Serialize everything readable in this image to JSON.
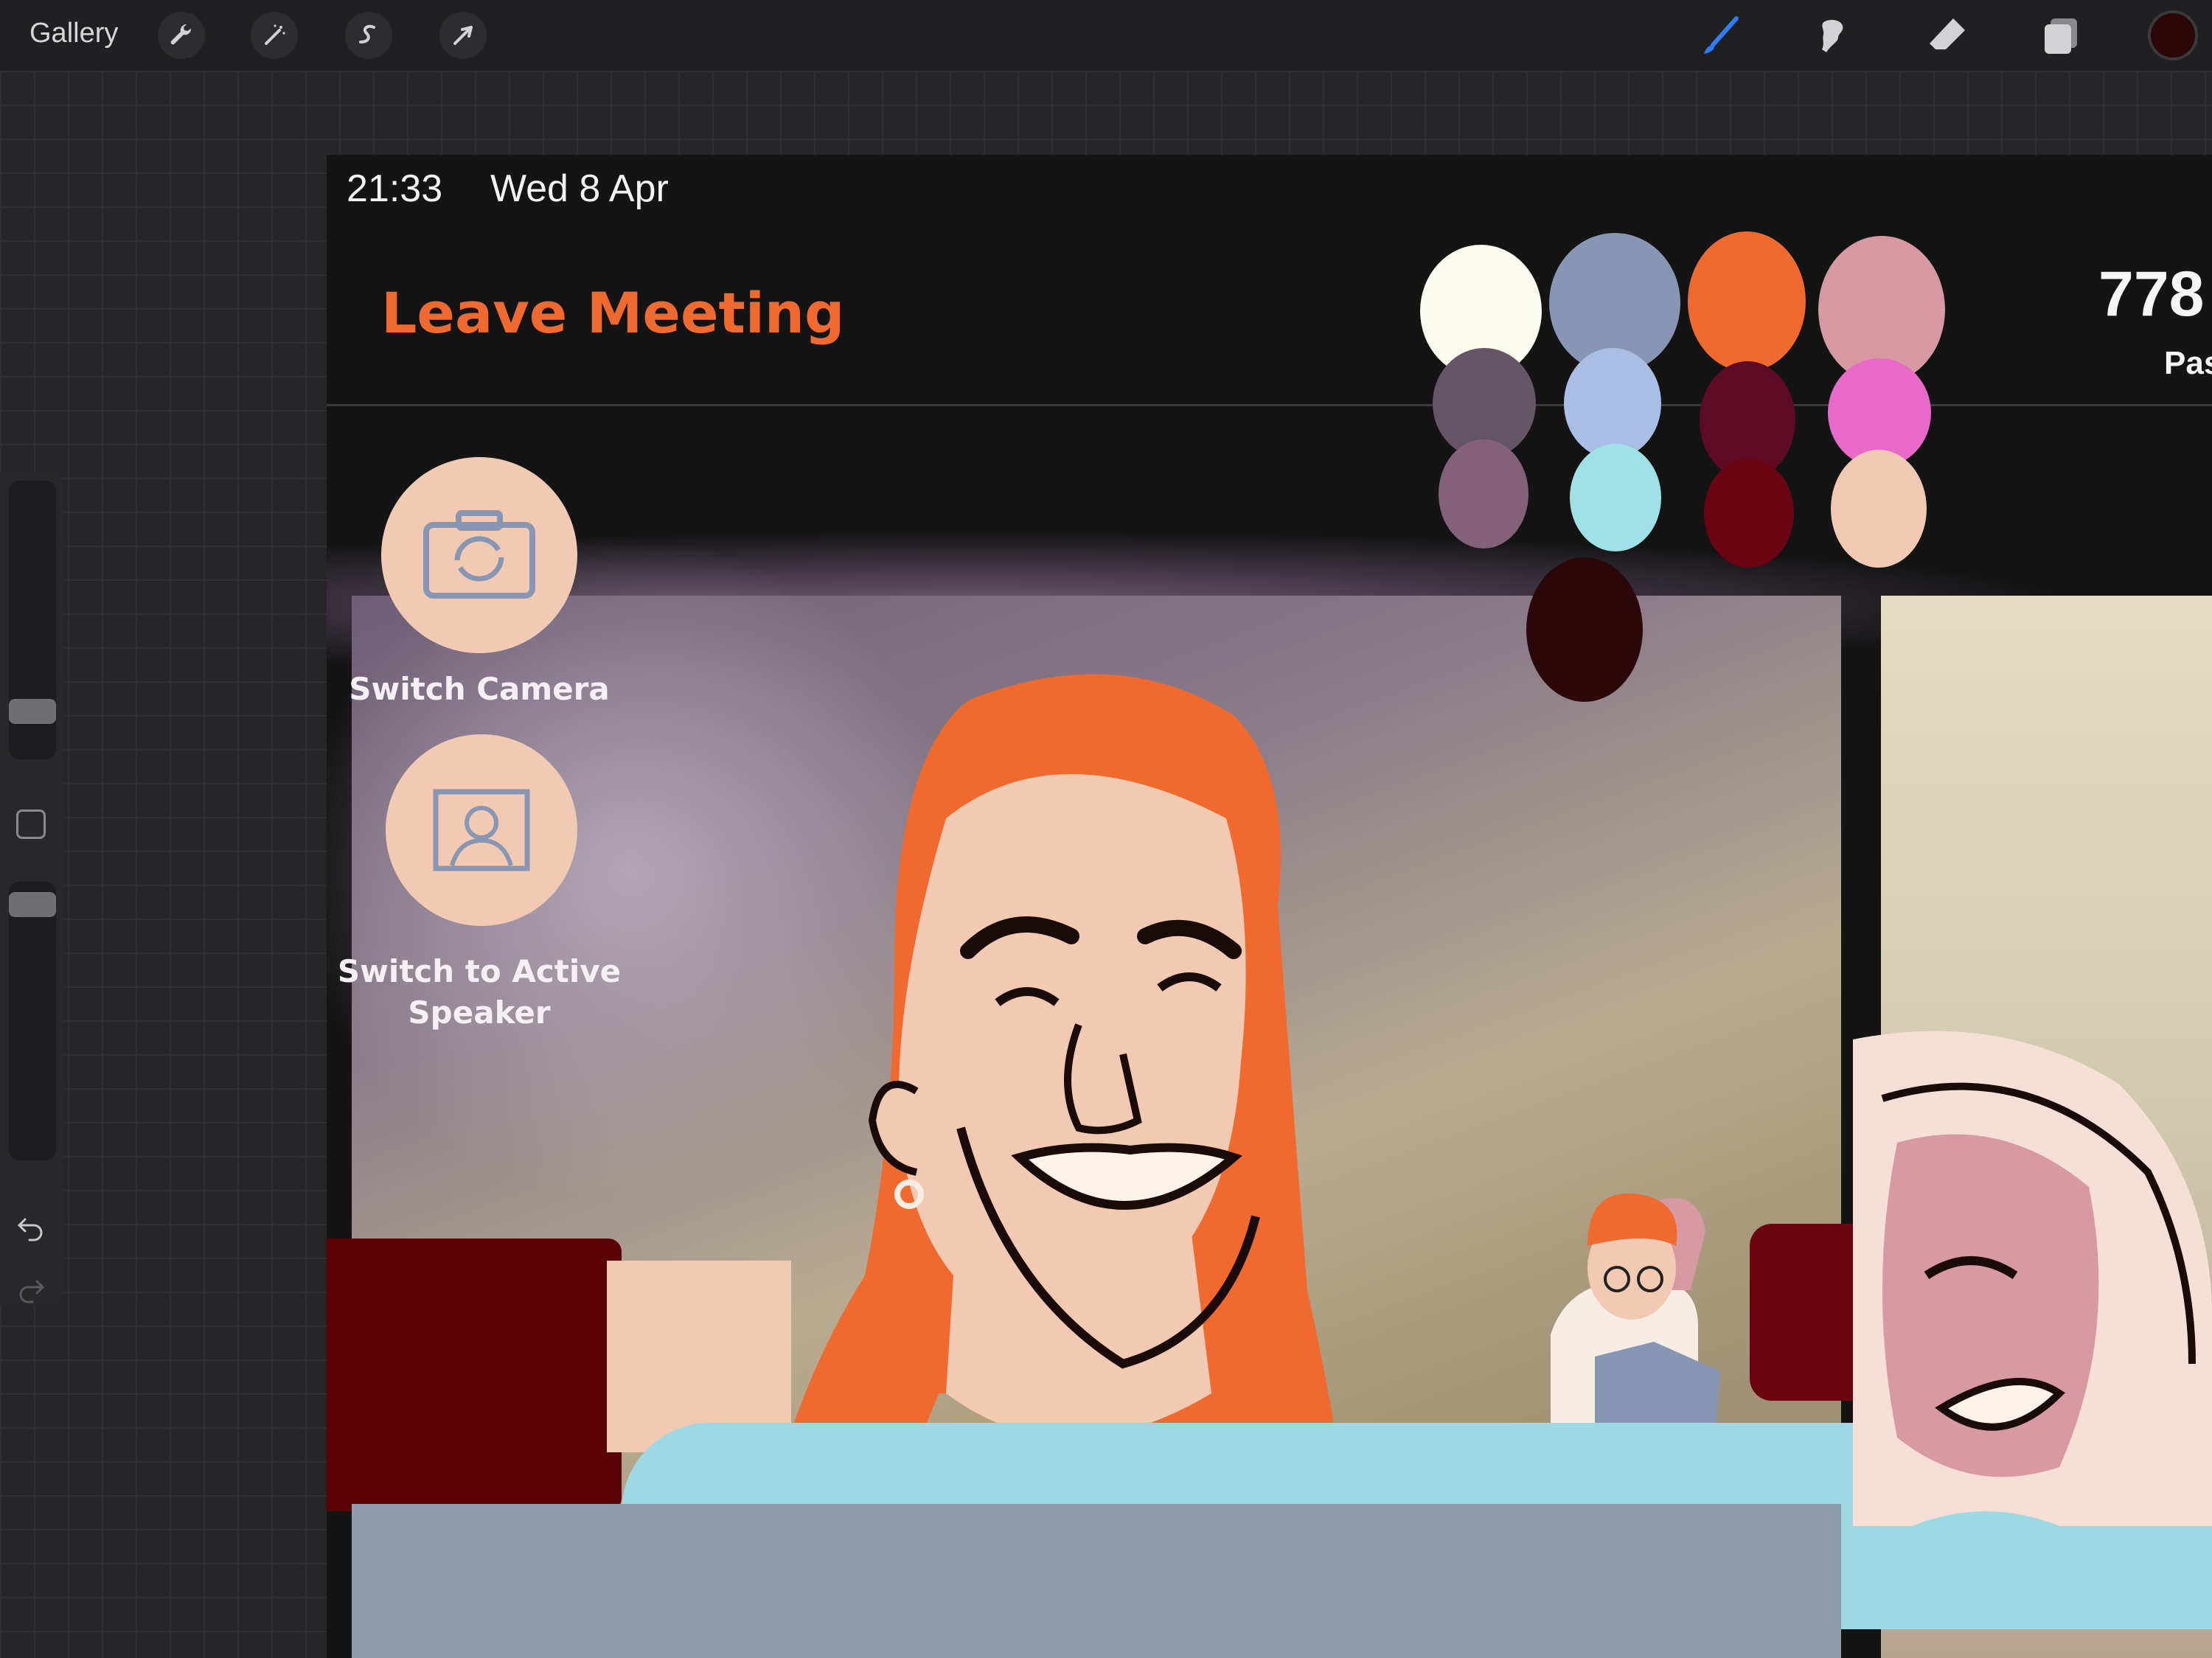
{
  "toolbar": {
    "gallery_label": "Gallery",
    "left_tools": [
      "wrench-icon",
      "magic-wand-icon",
      "selection-icon",
      "transform-arrow-icon"
    ],
    "right_tools": [
      "brush-icon",
      "smudge-icon",
      "eraser-icon",
      "layers-icon"
    ],
    "current_color": "#2b0707",
    "active_tool_color": "#2f7cf6"
  },
  "sidebar": {
    "brush_size_label": "brush-size-slider",
    "opacity_label": "opacity-slider",
    "modify_button": "modify-square-icon",
    "undo": "undo-icon",
    "redo": "redo-icon"
  },
  "artwork": {
    "status_time": "21:33",
    "status_date": "Wed 8 Apr",
    "leave_meeting": "Leave Meeting",
    "meeting_number_partial": "778",
    "meeting_sub_partial": "Pas",
    "switch_camera_label": "Switch Camera",
    "switch_speaker_label": "Switch to Active Speaker",
    "palette": [
      "#fbfbf0",
      "#8797b3",
      "#f06a2f",
      "#d89aa2",
      "#665566",
      "#a9bde5",
      "#5e0b25",
      "#e86ac8",
      "#836178",
      "#9fe1e6",
      "#6a0410",
      "#f2c9b3",
      "#2a0708"
    ]
  }
}
